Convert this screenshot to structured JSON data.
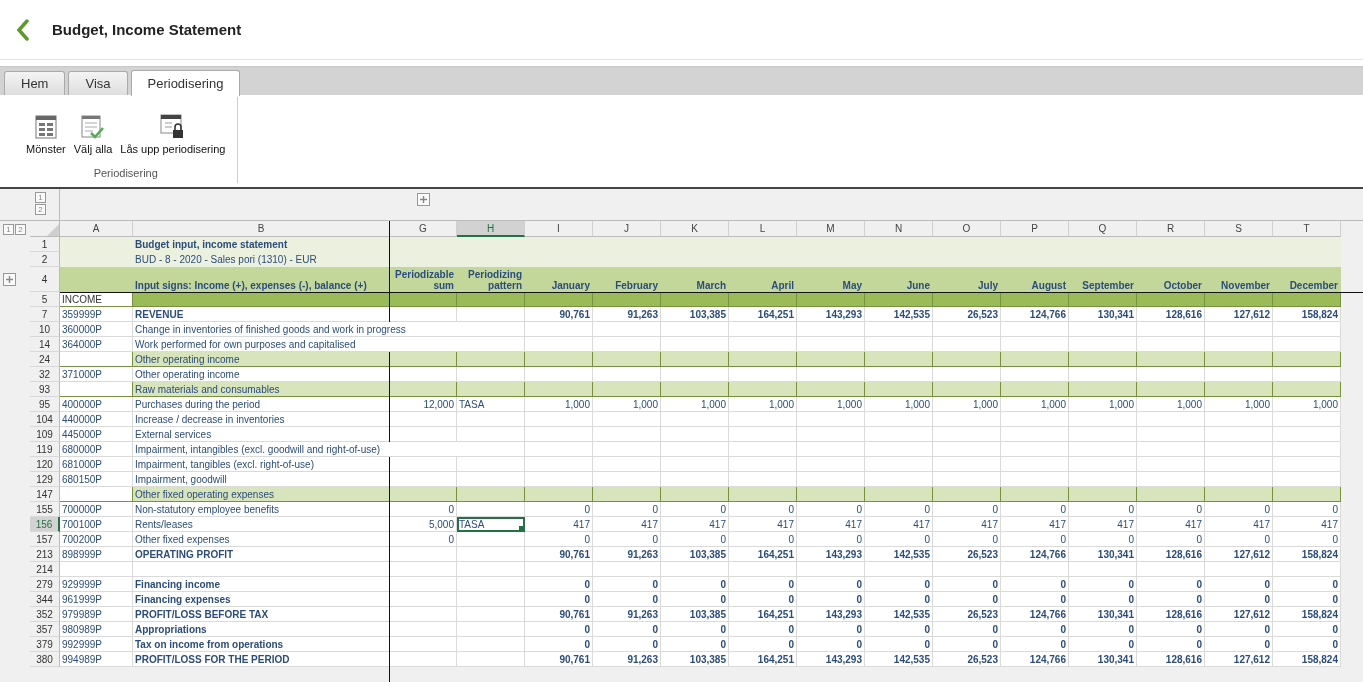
{
  "app": {
    "title": "Budget, Income Statement"
  },
  "tabs": [
    {
      "label": "Hem",
      "selected": false
    },
    {
      "label": "Visa",
      "selected": false
    },
    {
      "label": "Periodisering",
      "selected": true
    }
  ],
  "ribbon": {
    "group_label": "Periodisering",
    "buttons": [
      {
        "kind": "pattern",
        "label": "Mönster"
      },
      {
        "kind": "select_all",
        "label": "Välj alla"
      },
      {
        "kind": "unlock",
        "label": "Lås upp periodisering"
      }
    ]
  },
  "outline": {
    "column_levels": [
      "1",
      "2"
    ],
    "row_levels": [
      "1",
      "2"
    ]
  },
  "sheet": {
    "columns": [
      {
        "label": "A",
        "selected": false
      },
      {
        "label": "B",
        "selected": false
      },
      {
        "label": "G",
        "selected": false
      },
      {
        "label": "H",
        "selected": true
      },
      {
        "label": "I",
        "selected": false
      },
      {
        "label": "J",
        "selected": false
      },
      {
        "label": "K",
        "selected": false
      },
      {
        "label": "L",
        "selected": false
      },
      {
        "label": "M",
        "selected": false
      },
      {
        "label": "N",
        "selected": false
      },
      {
        "label": "O",
        "selected": false
      },
      {
        "label": "P",
        "selected": false
      },
      {
        "label": "Q",
        "selected": false
      },
      {
        "label": "R",
        "selected": false
      },
      {
        "label": "S",
        "selected": false
      },
      {
        "label": "T",
        "selected": false
      }
    ],
    "rows": [
      {
        "num": "1",
        "kind": "title",
        "b": "Budget input, income statement",
        "selected": false
      },
      {
        "num": "2",
        "kind": "subtitle",
        "b": "BUD - 8 - 2020 - Sales pori (1310) - EUR",
        "selected": false
      },
      {
        "num": "4",
        "kind": "header",
        "b": "Input signs: Income (+), expenses (-), balance (+)",
        "labels": [
          "Periodizable sum",
          "Periodizing pattern",
          "January",
          "February",
          "March",
          "April",
          "May",
          "June",
          "July",
          "August",
          "September",
          "October",
          "November",
          "December"
        ],
        "selected": false
      },
      {
        "num": "5",
        "kind": "band",
        "a": "INCOME",
        "selected": false
      },
      {
        "num": "7",
        "kind": "total",
        "a": "359999P",
        "b": "REVENUE",
        "values": [
          "90,761",
          "91,263",
          "103,385",
          "164,251",
          "143,293",
          "142,535",
          "26,523",
          "124,766",
          "130,341",
          "128,616",
          "127,612",
          "158,824"
        ],
        "selected": false
      },
      {
        "num": "10",
        "kind": "data",
        "a": "360000P",
        "b": "Change in inventories of finished goods and work in progress",
        "selected": false
      },
      {
        "num": "14",
        "kind": "data",
        "a": "364000P",
        "b": "Work performed for own purposes and capitalised",
        "selected": false
      },
      {
        "num": "24",
        "kind": "section",
        "b": "Other operating income",
        "selected": false
      },
      {
        "num": "32",
        "kind": "data",
        "a": "371000P",
        "b": "Other operating income",
        "selected": false
      },
      {
        "num": "93",
        "kind": "section",
        "b": "Raw materials and consumables",
        "selected": false
      },
      {
        "num": "95",
        "kind": "data",
        "a": "400000P",
        "b": "Purchases during the period",
        "g": "12,000",
        "h": "TASA",
        "values": [
          "1,000",
          "1,000",
          "1,000",
          "1,000",
          "1,000",
          "1,000",
          "1,000",
          "1,000",
          "1,000",
          "1,000",
          "1,000",
          "1,000"
        ],
        "selected": false
      },
      {
        "num": "104",
        "kind": "data",
        "a": "440000P",
        "b": "Increase / decrease in inventories",
        "selected": false
      },
      {
        "num": "109",
        "kind": "data",
        "a": "445000P",
        "b": "External services",
        "selected": false
      },
      {
        "num": "119",
        "kind": "data",
        "a": "680000P",
        "b": "Impairment, intangibles (excl. goodwill and right-of-use)",
        "selected": false
      },
      {
        "num": "120",
        "kind": "data",
        "a": "681000P",
        "b": "Impairment, tangibles (excl. right-of-use)",
        "selected": false
      },
      {
        "num": "129",
        "kind": "data",
        "a": "680150P",
        "b": "Impairment, goodwill",
        "selected": false
      },
      {
        "num": "147",
        "kind": "section",
        "b": "Other fixed operating expenses",
        "selected": false
      },
      {
        "num": "155",
        "kind": "data",
        "a": "700000P",
        "b": "Non-statutory employee benefits",
        "g": "0",
        "values": [
          "0",
          "0",
          "0",
          "0",
          "0",
          "0",
          "0",
          "0",
          "0",
          "0",
          "0",
          "0"
        ],
        "selected": false
      },
      {
        "num": "156",
        "kind": "data",
        "a": "700100P",
        "b": "Rents/leases",
        "g": "5,000",
        "h": "TASA",
        "values": [
          "417",
          "417",
          "417",
          "417",
          "417",
          "417",
          "417",
          "417",
          "417",
          "417",
          "417",
          "417"
        ],
        "selected": true
      },
      {
        "num": "157",
        "kind": "data",
        "a": "700200P",
        "b": "Other fixed expenses",
        "g": "0",
        "values": [
          "0",
          "0",
          "0",
          "0",
          "0",
          "0",
          "0",
          "0",
          "0",
          "0",
          "0",
          "0"
        ],
        "selected": false
      },
      {
        "num": "213",
        "kind": "total",
        "a": "898999P",
        "b": "OPERATING PROFIT",
        "values": [
          "90,761",
          "91,263",
          "103,385",
          "164,251",
          "143,293",
          "142,535",
          "26,523",
          "124,766",
          "130,341",
          "128,616",
          "127,612",
          "158,824"
        ],
        "selected": false
      },
      {
        "num": "214",
        "kind": "data",
        "selected": false
      },
      {
        "num": "279",
        "kind": "total",
        "a": "929999P",
        "b": "Financing income",
        "values": [
          "0",
          "0",
          "0",
          "0",
          "0",
          "0",
          "0",
          "0",
          "0",
          "0",
          "0",
          "0"
        ],
        "selected": false
      },
      {
        "num": "344",
        "kind": "total",
        "a": "961999P",
        "b": "Financing expenses",
        "values": [
          "0",
          "0",
          "0",
          "0",
          "0",
          "0",
          "0",
          "0",
          "0",
          "0",
          "0",
          "0"
        ],
        "selected": false
      },
      {
        "num": "352",
        "kind": "total",
        "a": "979989P",
        "b": "PROFIT/LOSS BEFORE TAX",
        "values": [
          "90,761",
          "91,263",
          "103,385",
          "164,251",
          "143,293",
          "142,535",
          "26,523",
          "124,766",
          "130,341",
          "128,616",
          "127,612",
          "158,824"
        ],
        "selected": false
      },
      {
        "num": "357",
        "kind": "total",
        "a": "980989P",
        "b": "Appropriations",
        "values": [
          "0",
          "0",
          "0",
          "0",
          "0",
          "0",
          "0",
          "0",
          "0",
          "0",
          "0",
          "0"
        ],
        "selected": false
      },
      {
        "num": "379",
        "kind": "total",
        "a": "992999P",
        "b": "Tax on income from operations",
        "values": [
          "0",
          "0",
          "0",
          "0",
          "0",
          "0",
          "0",
          "0",
          "0",
          "0",
          "0",
          "0"
        ],
        "selected": false
      },
      {
        "num": "380",
        "kind": "total",
        "a": "994989P",
        "b": "PROFIT/LOSS FOR THE PERIOD",
        "values": [
          "90,761",
          "91,263",
          "103,385",
          "164,251",
          "143,293",
          "142,535",
          "26,523",
          "124,766",
          "130,341",
          "128,616",
          "127,612",
          "158,824"
        ],
        "selected": false
      }
    ]
  }
}
